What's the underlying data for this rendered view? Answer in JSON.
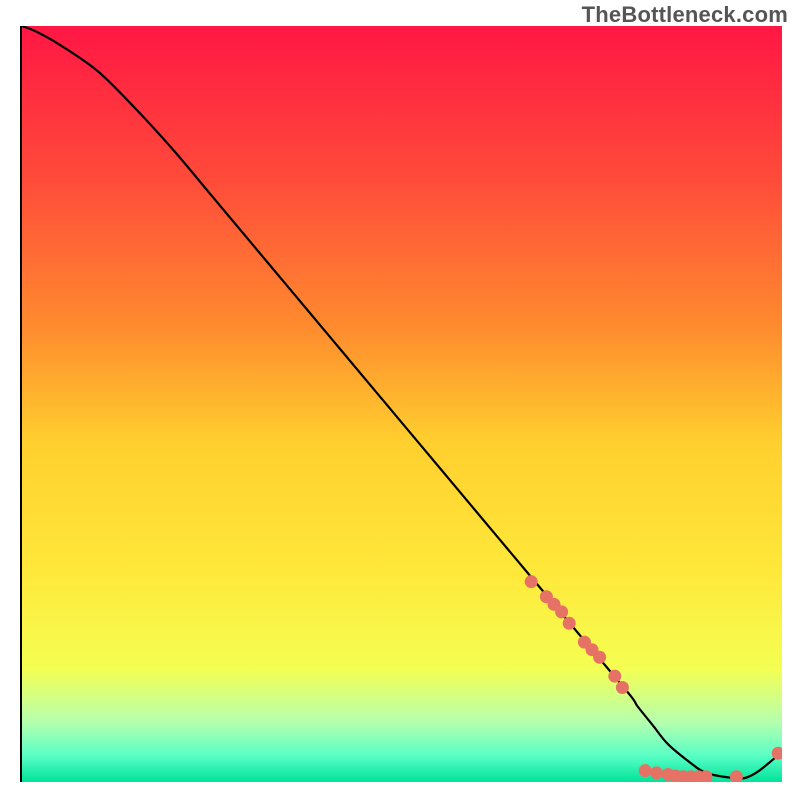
{
  "watermark": {
    "text": "TheBottleneck.com"
  },
  "chart_data": {
    "type": "line",
    "title": "",
    "xlabel": "",
    "ylabel": "",
    "xlim": [
      0,
      100
    ],
    "ylim": [
      0,
      100
    ],
    "grid": false,
    "gradient_stops": [
      {
        "offset": 0.0,
        "color": "#ff1744"
      },
      {
        "offset": 0.2,
        "color": "#ff4a3a"
      },
      {
        "offset": 0.4,
        "color": "#ff8c2e"
      },
      {
        "offset": 0.55,
        "color": "#ffcf2e"
      },
      {
        "offset": 0.72,
        "color": "#ffe83a"
      },
      {
        "offset": 0.85,
        "color": "#f4ff52"
      },
      {
        "offset": 0.92,
        "color": "#b6ffad"
      },
      {
        "offset": 0.965,
        "color": "#5affc6"
      },
      {
        "offset": 1.0,
        "color": "#00e39a"
      }
    ],
    "curve": {
      "x": [
        0,
        2,
        5,
        10,
        15,
        20,
        25,
        30,
        35,
        40,
        45,
        50,
        55,
        60,
        65,
        70,
        75,
        80,
        81,
        83,
        85,
        88,
        90,
        93,
        95,
        97,
        100
      ],
      "y": [
        100,
        99.2,
        97.5,
        94,
        89,
        83.5,
        77.5,
        71.5,
        65.5,
        59.5,
        53.5,
        47.5,
        41.5,
        35.5,
        29.5,
        23.5,
        17.5,
        11.5,
        10,
        7.5,
        5,
        2.5,
        1.2,
        0.6,
        0.5,
        1.5,
        4
      ]
    },
    "markers": [
      {
        "x": 67,
        "y": 26.5
      },
      {
        "x": 69,
        "y": 24.5
      },
      {
        "x": 70,
        "y": 23.5
      },
      {
        "x": 71,
        "y": 22.5
      },
      {
        "x": 72,
        "y": 21
      },
      {
        "x": 74,
        "y": 18.5
      },
      {
        "x": 75,
        "y": 17.5
      },
      {
        "x": 76,
        "y": 16.5
      },
      {
        "x": 78,
        "y": 14
      },
      {
        "x": 79,
        "y": 12.5
      },
      {
        "x": 82,
        "y": 1.5
      },
      {
        "x": 83.5,
        "y": 1.2
      },
      {
        "x": 85,
        "y": 1.0
      },
      {
        "x": 86,
        "y": 0.8
      },
      {
        "x": 87,
        "y": 0.7
      },
      {
        "x": 88,
        "y": 0.7
      },
      {
        "x": 89,
        "y": 0.7
      },
      {
        "x": 90,
        "y": 0.7
      },
      {
        "x": 94,
        "y": 0.7
      },
      {
        "x": 99.5,
        "y": 3.8
      }
    ]
  }
}
